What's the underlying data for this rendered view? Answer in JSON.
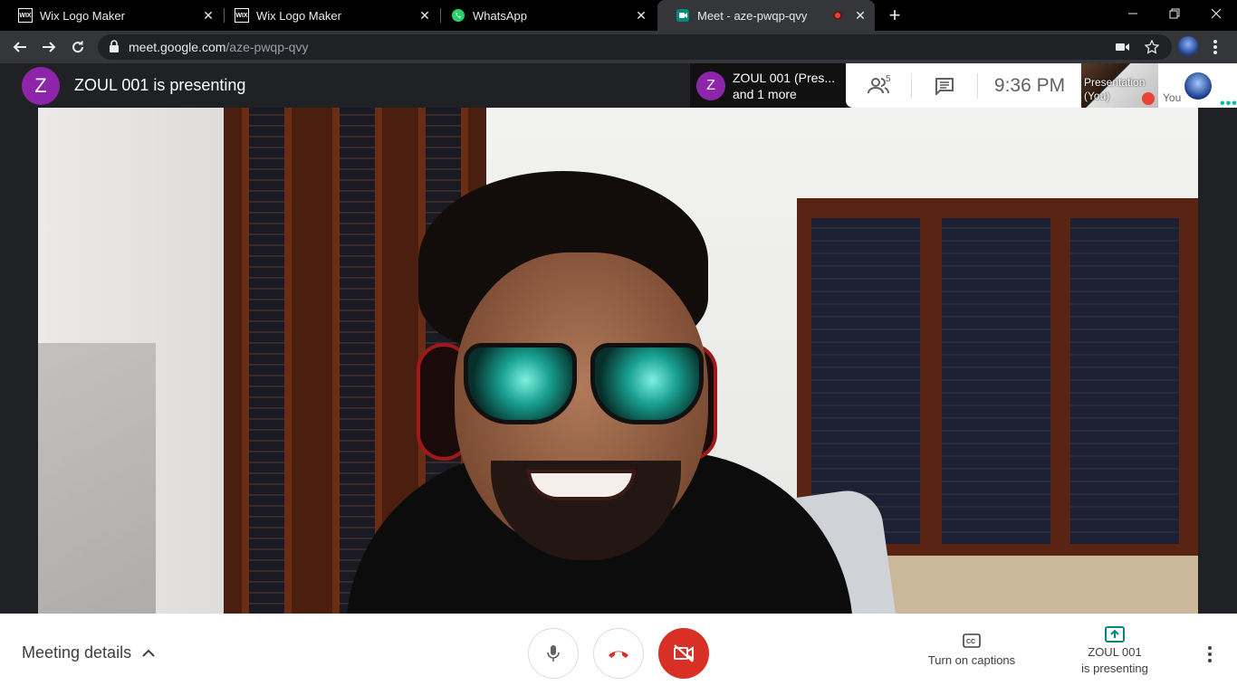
{
  "browser": {
    "tabs": [
      {
        "title": "Wix Logo Maker",
        "favicon": "wix-icon",
        "active": false
      },
      {
        "title": "Wix Logo Maker",
        "favicon": "wix-icon",
        "active": false
      },
      {
        "title": "WhatsApp",
        "favicon": "whatsapp-icon",
        "active": false
      },
      {
        "title": "Meet - aze-pwqp-qvy",
        "favicon": "meet-icon",
        "active": true,
        "recording": true
      }
    ],
    "wix_favicon_text": "WIX",
    "new_tab_symbol": "+",
    "url_host": "meet.google.com",
    "url_path": "/aze-pwqp-qvy"
  },
  "meet": {
    "presenter_initial": "Z",
    "presenting_text": "ZOUL 001 is presenting",
    "stack_tile": {
      "initial": "Z",
      "line1": "ZOUL 001 (Pres...",
      "line2": "and 1 more"
    },
    "participant_count": "5",
    "time": "9:36  PM",
    "self_tile_label_1": "Presentation",
    "self_tile_label_2": "(You)",
    "you_label": "You",
    "you_dots": "•••"
  },
  "controls": {
    "meeting_details": "Meeting details",
    "captions_label": "Turn on captions",
    "present_line1": "ZOUL 001",
    "present_line2": "is presenting"
  },
  "colors": {
    "end_call": "#d93025",
    "avatar": "#8e24aa",
    "recording": "#ea4335",
    "accent_teal": "#00bfa5"
  }
}
